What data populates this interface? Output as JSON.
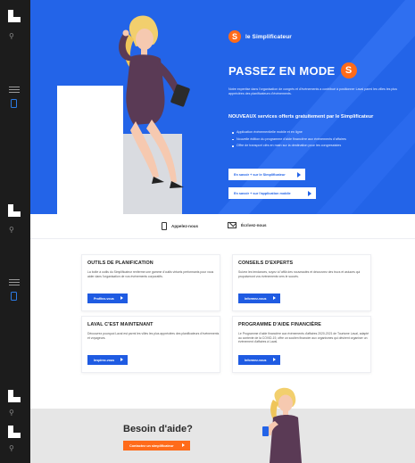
{
  "brand": {
    "name": "le Simplificateur",
    "badge_letter": "S"
  },
  "hero": {
    "title": "PASSEZ EN MODE",
    "title_badge": "S",
    "description": "Notre expertise dans l'organisation de congrès et d'événements a contribué à positionner Laval parmi les villes les plus appréciées des planificateurs d'événements.",
    "subtitle": "NOUVEAUX services offerts gratuitement par le Simplificateur",
    "list": [
      "Application événementielle mobile et en ligne",
      "Nouvelle édition du programme d'aide financière aux événements d'affaires",
      "Offre de transport clés en main sur la destination pour les congressistes"
    ],
    "btn1": "En savoir + sur le Simplificateur",
    "btn2": "En savoir + sur l'application mobile"
  },
  "contact": {
    "call": "Appelez-nous",
    "write": "Écrivez-nous"
  },
  "cards": [
    {
      "title": "OUTILS DE PLANIFICATION",
      "text": "La boîte à outils du Simplificateur renferme une gamme d'outils virtuels performants pour vous aider dans l'organisation de vos événements corporatifs.",
      "button": "Profitez-vous"
    },
    {
      "title": "CONSEILS D'EXPERTS",
      "text": "Suivez les tendances, soyez à l'affût des nouveautés et découvrez des trucs et astuces qui propulseront vos événements vers le succès.",
      "button": "Informez-vous"
    },
    {
      "title": "LAVAL C'EST MAINTENANT",
      "text": "Découvrez pourquoi Laval est parmi les villes les plus appréciées des planificateurs d'événements et voyageurs.",
      "button": "Inspirez-vous"
    },
    {
      "title": "PROGRAMME D'AIDE FINANCIÈRE",
      "text": "Le Programme d'aide financière aux événements d'affaires 2020-2021 de Tourisme Laval, adapté au contexte de la COVID-19, offre un soutien financier aux organismes qui désirent organiser un événement d'affaires à Laval.",
      "button": "Informez-vous"
    }
  ],
  "help": {
    "title": "Besoin d'aide?",
    "button": "Contactez un simplificateur"
  },
  "colors": {
    "hero_blue": "#2364e8",
    "accent_orange": "#ff6b1a",
    "rail": "#1c1c1c",
    "help_bg": "#e6e6e6"
  },
  "icons": [
    "logo-icon",
    "search-icon",
    "menu-icon",
    "phone-icon",
    "envelope-icon",
    "arrow-right-icon"
  ]
}
